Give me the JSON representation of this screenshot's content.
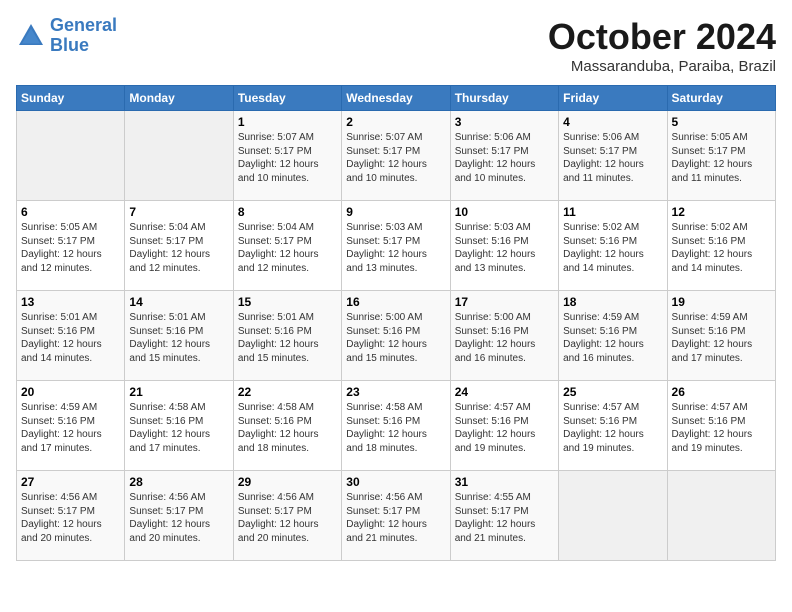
{
  "header": {
    "logo_line1": "General",
    "logo_line2": "Blue",
    "month": "October 2024",
    "location": "Massaranduba, Paraiba, Brazil"
  },
  "weekdays": [
    "Sunday",
    "Monday",
    "Tuesday",
    "Wednesday",
    "Thursday",
    "Friday",
    "Saturday"
  ],
  "weeks": [
    [
      {
        "day": "",
        "info": ""
      },
      {
        "day": "",
        "info": ""
      },
      {
        "day": "1",
        "info": "Sunrise: 5:07 AM\nSunset: 5:17 PM\nDaylight: 12 hours\nand 10 minutes."
      },
      {
        "day": "2",
        "info": "Sunrise: 5:07 AM\nSunset: 5:17 PM\nDaylight: 12 hours\nand 10 minutes."
      },
      {
        "day": "3",
        "info": "Sunrise: 5:06 AM\nSunset: 5:17 PM\nDaylight: 12 hours\nand 10 minutes."
      },
      {
        "day": "4",
        "info": "Sunrise: 5:06 AM\nSunset: 5:17 PM\nDaylight: 12 hours\nand 11 minutes."
      },
      {
        "day": "5",
        "info": "Sunrise: 5:05 AM\nSunset: 5:17 PM\nDaylight: 12 hours\nand 11 minutes."
      }
    ],
    [
      {
        "day": "6",
        "info": "Sunrise: 5:05 AM\nSunset: 5:17 PM\nDaylight: 12 hours\nand 12 minutes."
      },
      {
        "day": "7",
        "info": "Sunrise: 5:04 AM\nSunset: 5:17 PM\nDaylight: 12 hours\nand 12 minutes."
      },
      {
        "day": "8",
        "info": "Sunrise: 5:04 AM\nSunset: 5:17 PM\nDaylight: 12 hours\nand 12 minutes."
      },
      {
        "day": "9",
        "info": "Sunrise: 5:03 AM\nSunset: 5:17 PM\nDaylight: 12 hours\nand 13 minutes."
      },
      {
        "day": "10",
        "info": "Sunrise: 5:03 AM\nSunset: 5:16 PM\nDaylight: 12 hours\nand 13 minutes."
      },
      {
        "day": "11",
        "info": "Sunrise: 5:02 AM\nSunset: 5:16 PM\nDaylight: 12 hours\nand 14 minutes."
      },
      {
        "day": "12",
        "info": "Sunrise: 5:02 AM\nSunset: 5:16 PM\nDaylight: 12 hours\nand 14 minutes."
      }
    ],
    [
      {
        "day": "13",
        "info": "Sunrise: 5:01 AM\nSunset: 5:16 PM\nDaylight: 12 hours\nand 14 minutes."
      },
      {
        "day": "14",
        "info": "Sunrise: 5:01 AM\nSunset: 5:16 PM\nDaylight: 12 hours\nand 15 minutes."
      },
      {
        "day": "15",
        "info": "Sunrise: 5:01 AM\nSunset: 5:16 PM\nDaylight: 12 hours\nand 15 minutes."
      },
      {
        "day": "16",
        "info": "Sunrise: 5:00 AM\nSunset: 5:16 PM\nDaylight: 12 hours\nand 15 minutes."
      },
      {
        "day": "17",
        "info": "Sunrise: 5:00 AM\nSunset: 5:16 PM\nDaylight: 12 hours\nand 16 minutes."
      },
      {
        "day": "18",
        "info": "Sunrise: 4:59 AM\nSunset: 5:16 PM\nDaylight: 12 hours\nand 16 minutes."
      },
      {
        "day": "19",
        "info": "Sunrise: 4:59 AM\nSunset: 5:16 PM\nDaylight: 12 hours\nand 17 minutes."
      }
    ],
    [
      {
        "day": "20",
        "info": "Sunrise: 4:59 AM\nSunset: 5:16 PM\nDaylight: 12 hours\nand 17 minutes."
      },
      {
        "day": "21",
        "info": "Sunrise: 4:58 AM\nSunset: 5:16 PM\nDaylight: 12 hours\nand 17 minutes."
      },
      {
        "day": "22",
        "info": "Sunrise: 4:58 AM\nSunset: 5:16 PM\nDaylight: 12 hours\nand 18 minutes."
      },
      {
        "day": "23",
        "info": "Sunrise: 4:58 AM\nSunset: 5:16 PM\nDaylight: 12 hours\nand 18 minutes."
      },
      {
        "day": "24",
        "info": "Sunrise: 4:57 AM\nSunset: 5:16 PM\nDaylight: 12 hours\nand 19 minutes."
      },
      {
        "day": "25",
        "info": "Sunrise: 4:57 AM\nSunset: 5:16 PM\nDaylight: 12 hours\nand 19 minutes."
      },
      {
        "day": "26",
        "info": "Sunrise: 4:57 AM\nSunset: 5:16 PM\nDaylight: 12 hours\nand 19 minutes."
      }
    ],
    [
      {
        "day": "27",
        "info": "Sunrise: 4:56 AM\nSunset: 5:17 PM\nDaylight: 12 hours\nand 20 minutes."
      },
      {
        "day": "28",
        "info": "Sunrise: 4:56 AM\nSunset: 5:17 PM\nDaylight: 12 hours\nand 20 minutes."
      },
      {
        "day": "29",
        "info": "Sunrise: 4:56 AM\nSunset: 5:17 PM\nDaylight: 12 hours\nand 20 minutes."
      },
      {
        "day": "30",
        "info": "Sunrise: 4:56 AM\nSunset: 5:17 PM\nDaylight: 12 hours\nand 21 minutes."
      },
      {
        "day": "31",
        "info": "Sunrise: 4:55 AM\nSunset: 5:17 PM\nDaylight: 12 hours\nand 21 minutes."
      },
      {
        "day": "",
        "info": ""
      },
      {
        "day": "",
        "info": ""
      }
    ]
  ]
}
